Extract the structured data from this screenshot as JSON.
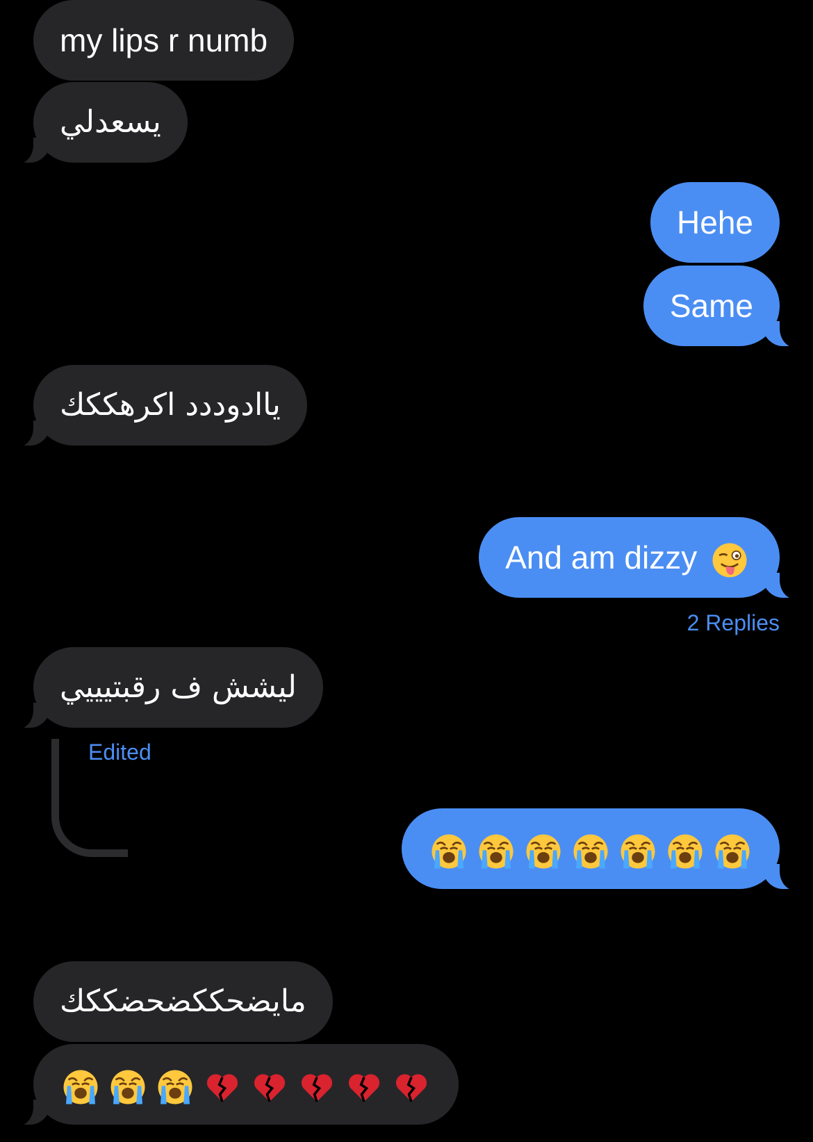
{
  "messages": [
    {
      "id": "m1",
      "text": "my lips r numb"
    },
    {
      "id": "m2",
      "text": "يسعدلي"
    },
    {
      "id": "m3",
      "text": "Hehe"
    },
    {
      "id": "m4",
      "text": "Same"
    },
    {
      "id": "m5",
      "text": "ياادوددد اكرهككك"
    },
    {
      "id": "m6",
      "text": "And am dizzy"
    },
    {
      "id": "m7",
      "text": "ليشش ف رقبتيييي"
    },
    {
      "id": "m8",
      "text": "مايضحككضحضككك"
    }
  ],
  "replies_label": "2 Replies",
  "edited_label": "Edited",
  "emoji_names": {
    "m6": [
      "winking-face-with-tongue"
    ],
    "m_sent_cry": [
      "loudly-crying-face",
      "loudly-crying-face",
      "loudly-crying-face",
      "loudly-crying-face",
      "loudly-crying-face",
      "loudly-crying-face",
      "loudly-crying-face"
    ],
    "m_recv_last": [
      "loudly-crying-face",
      "loudly-crying-face",
      "loudly-crying-face",
      "broken-heart",
      "broken-heart",
      "broken-heart",
      "broken-heart",
      "broken-heart"
    ]
  },
  "colors": {
    "background": "#000000",
    "received_bubble": "#262628",
    "sent_bubble": "#4b8ef3",
    "link_blue": "#4b8ef3"
  }
}
